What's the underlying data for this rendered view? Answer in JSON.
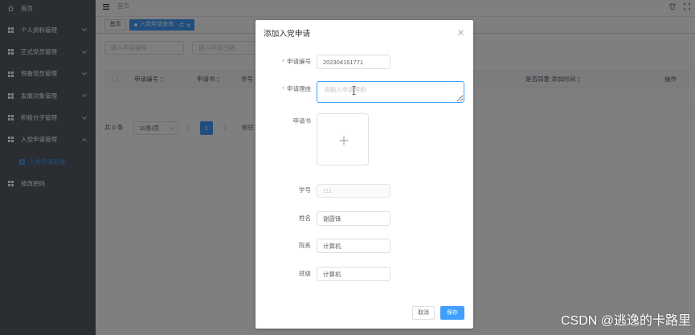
{
  "colors": {
    "sidebar_bg": "#545c64",
    "primary": "#409eff",
    "required": "#f56c6c",
    "overlay": "rgba(0,0,0,0.5)"
  },
  "sidebar": {
    "items": [
      {
        "label": "首页",
        "icon": "home-icon"
      },
      {
        "label": "个人资料管理",
        "icon": "grid-icon",
        "expanded": false
      },
      {
        "label": "正式党员管理",
        "icon": "grid-icon",
        "expanded": false
      },
      {
        "label": "预备党员管理",
        "icon": "grid-icon",
        "expanded": false
      },
      {
        "label": "发展对象管理",
        "icon": "grid-icon",
        "expanded": false
      },
      {
        "label": "积极分子管理",
        "icon": "grid-icon",
        "expanded": false
      },
      {
        "label": "入党申请管理",
        "icon": "grid-icon",
        "expanded": true
      },
      {
        "label": "入党申请查询",
        "icon": "grid-icon",
        "submenu": true,
        "active": true
      },
      {
        "label": "修改密码",
        "icon": "grid-icon"
      }
    ]
  },
  "header": {
    "breadcrumb": "首页",
    "icons": [
      "menu-toggle-icon",
      "shirt-icon",
      "fullscreen-icon"
    ]
  },
  "tabs": [
    {
      "label": "首页",
      "active": false
    },
    {
      "label": "入党申请查询",
      "active": true
    }
  ],
  "search": {
    "apply_no_placeholder": "输入申请编号",
    "apply_date_placeholder": "输入申请日期"
  },
  "table": {
    "columns": [
      {
        "label": "申请编号",
        "sortable": true
      },
      {
        "label": "申请书",
        "sortable": true
      },
      {
        "label": "学号",
        "sortable": false
      },
      {
        "label": "是否同意",
        "sortable": false
      },
      {
        "label": "添加时间",
        "sortable": true
      },
      {
        "label": "操作",
        "sortable": false
      }
    ]
  },
  "pagination": {
    "total": "共 0 条",
    "page_size": "10条/页",
    "current_page": "1",
    "goto": "前往"
  },
  "dialog": {
    "title": "添加入党申请",
    "required_mark": "*",
    "fields": [
      {
        "label": "申请编号",
        "required": true,
        "type": "input",
        "value": "202304161771"
      },
      {
        "label": "申请理由",
        "required": true,
        "type": "textarea",
        "value": "",
        "placeholder": "请输入申请理由"
      },
      {
        "label": "申请书",
        "required": false,
        "type": "upload"
      },
      {
        "label": "学号",
        "required": false,
        "type": "input",
        "value": "111",
        "disabled": true
      },
      {
        "label": "姓名",
        "required": false,
        "type": "input",
        "value": "谢霞锋"
      },
      {
        "label": "院系",
        "required": false,
        "type": "input",
        "value": "计算机"
      },
      {
        "label": "班级",
        "required": false,
        "type": "input",
        "value": "计算机"
      }
    ],
    "cancel_label": "取消",
    "save_label": "保存"
  },
  "watermark": "CSDN @逃逸的卡路里"
}
